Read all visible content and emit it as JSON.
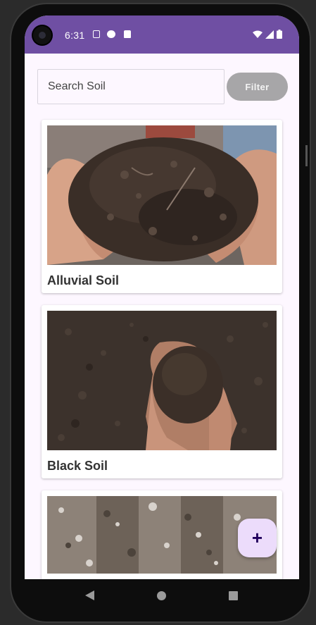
{
  "status_bar": {
    "time": "6:31",
    "icons": [
      "notification-a-icon",
      "notification-circle-icon",
      "notification-card-icon",
      "wifi-icon",
      "signal-icon",
      "battery-icon"
    ]
  },
  "search": {
    "placeholder": "Search Soil",
    "value": ""
  },
  "filter": {
    "label": "Filter"
  },
  "soil_cards": [
    {
      "title": "Alluvial Soil"
    },
    {
      "title": "Black Soil"
    },
    {
      "title": ""
    }
  ],
  "fab": {
    "label": "+"
  },
  "colors": {
    "status_bar": "#6f4fa3",
    "background": "#fdf7ff",
    "filter_button": "#a7a6a8",
    "fab": "#ecdcfb"
  },
  "nav_bar": {
    "icons": [
      "back-icon",
      "home-icon",
      "recents-icon"
    ]
  }
}
